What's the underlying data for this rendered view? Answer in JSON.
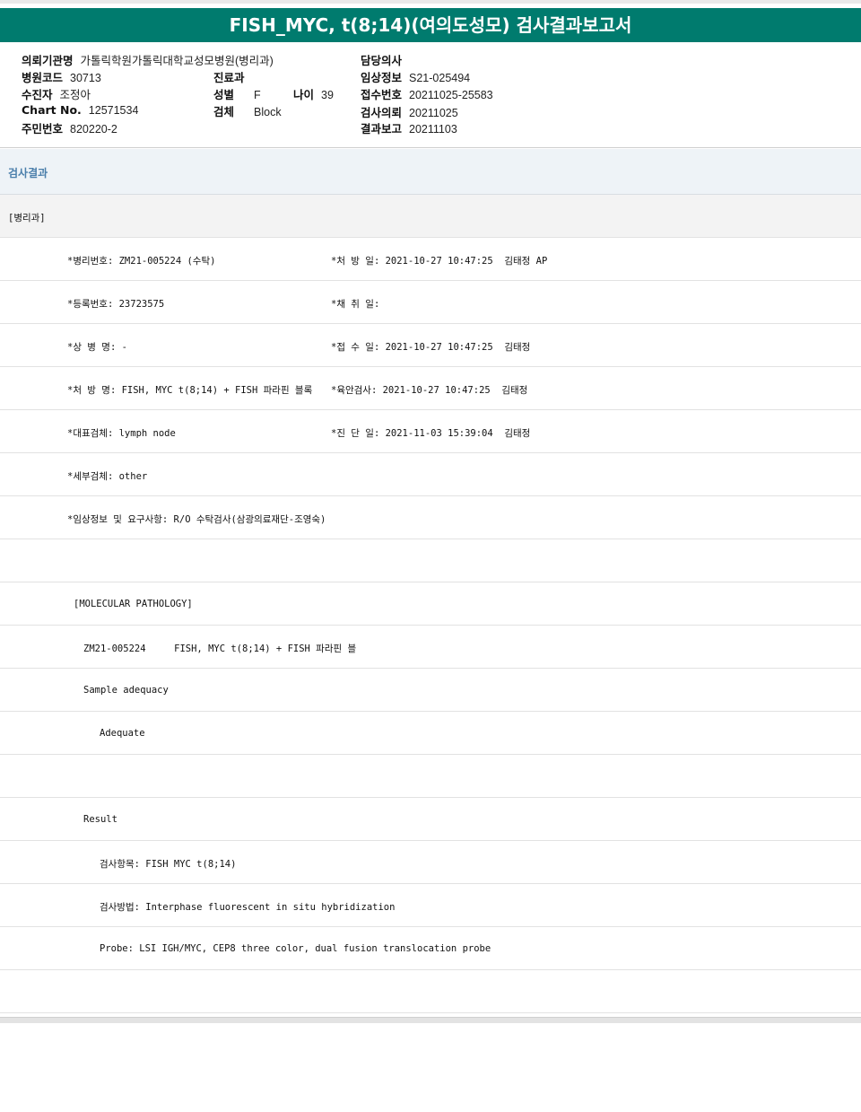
{
  "title": "FISH_MYC, t(8;14)(여의도성모) 검사결과보고서",
  "header": {
    "requesting_institution": {
      "label": "의뢰기관명",
      "value": "가톨릭학원가톨릭대학교성모병원(병리과)"
    },
    "attending_physician": {
      "label": "담당의사",
      "value": ""
    },
    "hospital_code": {
      "label": "병원코드",
      "value": "30713"
    },
    "department": {
      "label": "진료과",
      "value": ""
    },
    "clinical_info": {
      "label": "임상정보",
      "value": "S21-025494"
    },
    "patient": {
      "label": "수진자",
      "value": "조정아"
    },
    "sex": {
      "label": "성별",
      "value": "F"
    },
    "age": {
      "label": "나이",
      "value": "39"
    },
    "receipt_no": {
      "label": "접수번호",
      "value": "20211025-25583"
    },
    "chart_no": {
      "label": "Chart No.",
      "value": "12571534"
    },
    "specimen": {
      "label": "검체",
      "value": "Block"
    },
    "request_date": {
      "label": "검사의뢰",
      "value": "20211025"
    },
    "resident_no": {
      "label": "주민번호",
      "value": "820220-2"
    },
    "report_date": {
      "label": "결과보고",
      "value": "20211103"
    }
  },
  "results_heading": "검사결과",
  "rows": [
    {
      "text": "[병리과]",
      "gray": true
    },
    {
      "text": "*병리번호: ZM21-005224 (수탁)",
      "right": "*처 방 일: 2021-10-27 10:47:25  김태정 AP"
    },
    {
      "text": "*등록번호: 23723575",
      "right": "*채 취 일:"
    },
    {
      "text": "*상 병 명: -",
      "right": "*접 수 일: 2021-10-27 10:47:25  김태정"
    },
    {
      "text": "*처 방 명: FISH, MYC t(8;14) + FISH 파라핀 블록",
      "right": "*육안검사: 2021-10-27 10:47:25  김태정"
    },
    {
      "text": "*대표검체: lymph node",
      "right": "*진 단 일: 2021-11-03 15:39:04  김태정"
    },
    {
      "text": "*세부검체: other"
    },
    {
      "text": "*임상정보 및 요구사항: R/O 수탁검사(삼광의료재단-조영숙)"
    },
    {
      "text": ""
    },
    {
      "text": "[MOLECULAR PATHOLOGY]"
    },
    {
      "text": "ZM21-005224     FISH, MYC t(8;14) + FISH 파라핀 블"
    },
    {
      "text": "Sample adequacy"
    },
    {
      "text": "Adequate"
    },
    {
      "text": ""
    },
    {
      "text": "Result"
    },
    {
      "text": "검사항목: FISH MYC t(8;14)"
    },
    {
      "text": "검사방법: Interphase fluorescent in situ hybridization"
    },
    {
      "text": "Probe: LSI IGH/MYC, CEP8 three color, dual fusion translocation probe"
    },
    {
      "text": ""
    }
  ]
}
